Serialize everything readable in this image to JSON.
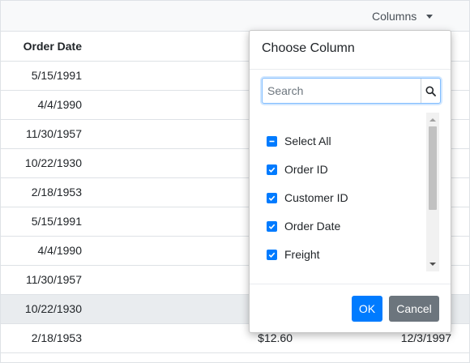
{
  "toolbar": {
    "columns_label": "Columns"
  },
  "table": {
    "header": {
      "order_date": "Order Date"
    },
    "rows": [
      {
        "order_date": "5/15/1991",
        "freight": "",
        "date2": ""
      },
      {
        "order_date": "4/4/1990",
        "freight": "",
        "date2": ""
      },
      {
        "order_date": "11/30/1957",
        "freight": "",
        "date2": ""
      },
      {
        "order_date": "10/22/1930",
        "freight": "",
        "date2": ""
      },
      {
        "order_date": "2/18/1953",
        "freight": "",
        "date2": ""
      },
      {
        "order_date": "5/15/1991",
        "freight": "",
        "date2": ""
      },
      {
        "order_date": "4/4/1990",
        "freight": "",
        "date2": ""
      },
      {
        "order_date": "11/30/1957",
        "freight": "",
        "date2": ""
      },
      {
        "order_date": "10/22/1930",
        "freight": "",
        "date2": ""
      },
      {
        "order_date": "2/18/1953",
        "freight": "$12.60",
        "date2": "12/3/1997"
      }
    ]
  },
  "popup": {
    "title": "Choose Column",
    "search_placeholder": "Search",
    "items": [
      {
        "label": "Select All",
        "state": "indeterminate"
      },
      {
        "label": "Order ID",
        "state": "checked"
      },
      {
        "label": "Customer ID",
        "state": "checked"
      },
      {
        "label": "Order Date",
        "state": "checked"
      },
      {
        "label": "Freight",
        "state": "checked"
      }
    ],
    "ok_label": "OK",
    "cancel_label": "Cancel"
  },
  "colors": {
    "accent": "#007bff",
    "secondary": "#6c757d"
  }
}
